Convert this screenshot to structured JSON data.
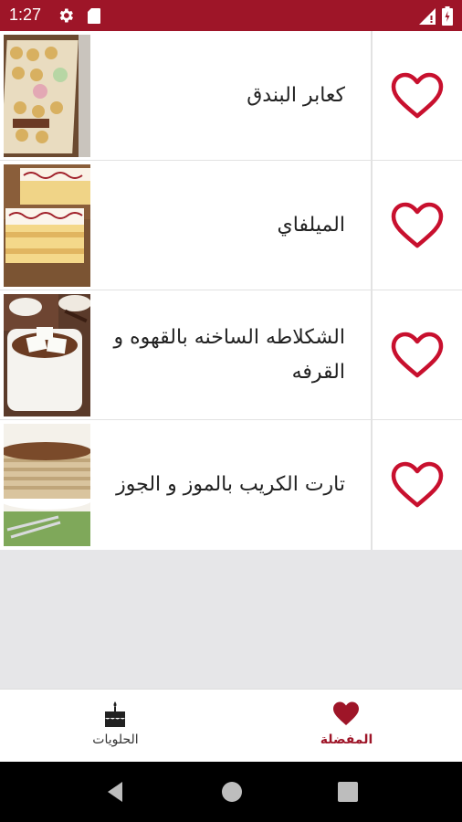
{
  "status_bar": {
    "time": "1:27",
    "icons": [
      "gear-icon",
      "sd-card-icon",
      "signal-icon",
      "battery-icon"
    ],
    "background": "#9e1528"
  },
  "recipes": [
    {
      "title": "كعابر البندق",
      "favorite": true,
      "image": "hazelnut-cookies-photo"
    },
    {
      "title": "الميلفاي",
      "favorite": true,
      "image": "millefeuille-photo"
    },
    {
      "title": "الشكلاطه الساخنه بالقهوه و القرفه",
      "favorite": true,
      "image": "hot-chocolate-photo"
    },
    {
      "title": "تارت الكريب بالموز و الجوز",
      "favorite": true,
      "image": "crepe-cake-photo"
    }
  ],
  "bottom_nav": {
    "sweets_label": "الحلويات",
    "favorites_label": "المفضلة",
    "active": "favorites"
  },
  "colors": {
    "accent": "#9e1528",
    "heart": "#c8102e",
    "empty_area": "#e6e6e8"
  }
}
